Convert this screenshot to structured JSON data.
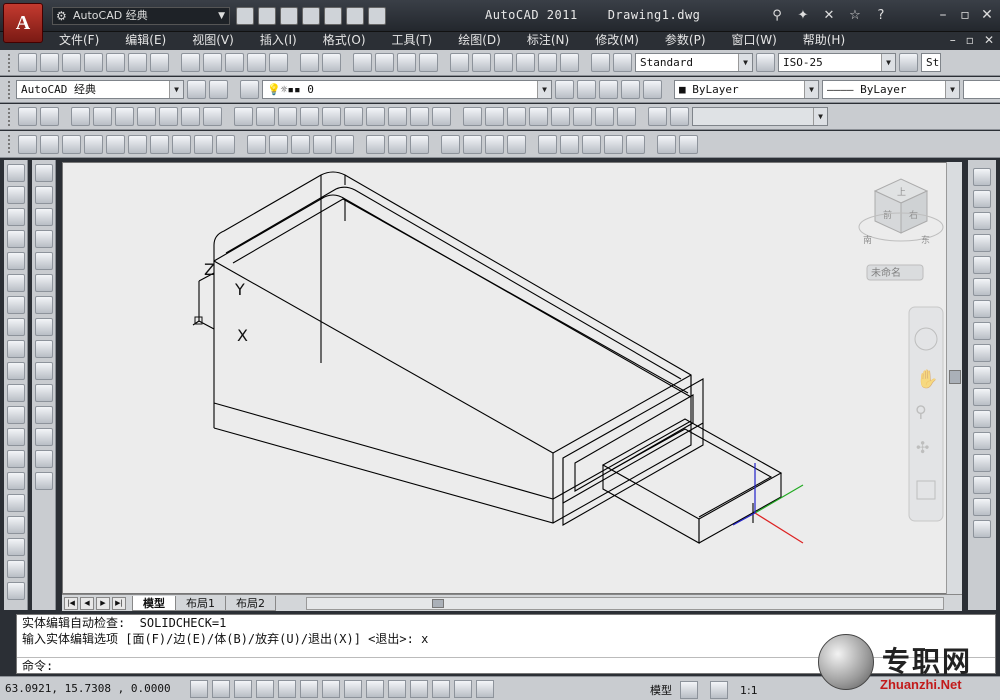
{
  "title": {
    "app": "AutoCAD 2011",
    "file": "Drawing1.dwg",
    "workspace": "AutoCAD 经典",
    "app_button": "A"
  },
  "menu": [
    "文件(F)",
    "编辑(E)",
    "视图(V)",
    "插入(I)",
    "格式(O)",
    "工具(T)",
    "绘图(D)",
    "标注(N)",
    "修改(M)",
    "参数(P)",
    "窗口(W)",
    "帮助(H)"
  ],
  "toolbar": {
    "text_style": "Standard",
    "dim_style": "ISO-25",
    "table_style_partial": "St",
    "workspace_combo": "AutoCAD 经典",
    "layer_value": "0",
    "color_value": "ByLayer",
    "linetype_value": "ByLayer"
  },
  "viewcube": {
    "top_label": "上",
    "front_label": "前",
    "right_label": "右",
    "south": "南",
    "east": "东",
    "wcs": "未命名"
  },
  "ucs_labels": {
    "x": "X",
    "y": "Y",
    "z": "Z"
  },
  "layout_tabs": [
    "模型",
    "布局1",
    "布局2"
  ],
  "command": {
    "line1": "实体编辑自动检查:  SOLIDCHECK=1",
    "line2": "输入实体编辑选项 [面(F)/边(E)/体(B)/放弃(U)/退出(X)] <退出>: x",
    "prompt": "命令:"
  },
  "status": {
    "coords": "63.0921, 15.7308 , 0.0000",
    "model_label": "模型",
    "scale": "1:1"
  },
  "watermark": {
    "big": "专职网",
    "small": "Zhuanzhi.Net"
  },
  "colors": {
    "wireframe": "#000000",
    "x_axis": "#d22",
    "y_axis": "#2a2",
    "z_axis": "#22c",
    "viewport_bg": "#ececec"
  }
}
